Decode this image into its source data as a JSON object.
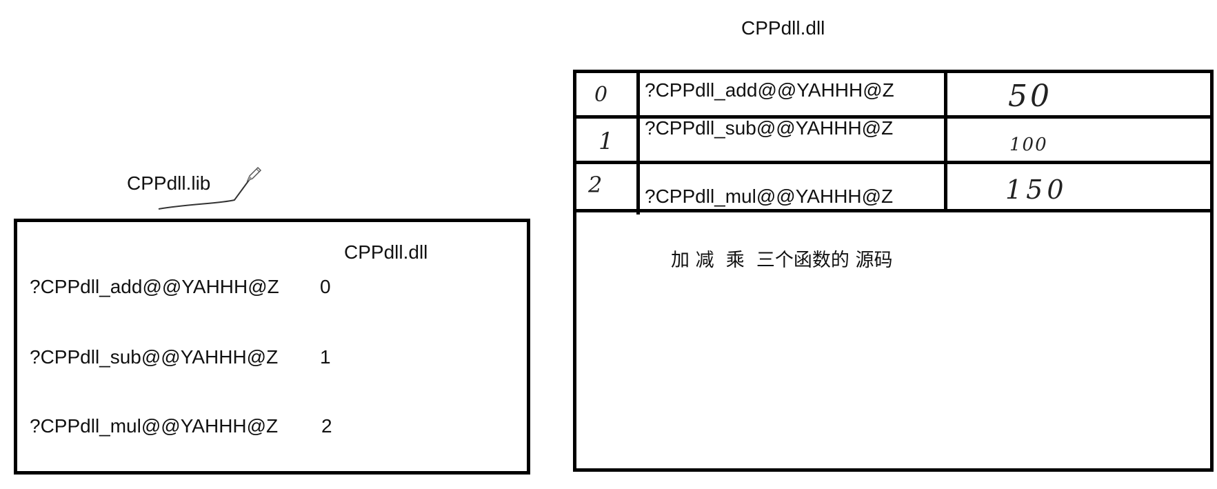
{
  "lib_panel": {
    "title": "CPPdll.lib",
    "inner_title": "CPPdll.dll",
    "exports": [
      {
        "symbol": "?CPPdll_add@@YAHHH@Z",
        "ordinal": "0"
      },
      {
        "symbol": "?CPPdll_sub@@YAHHH@Z",
        "ordinal": "1"
      },
      {
        "symbol": "?CPPdll_mul@@YAHHH@Z",
        "ordinal": "2"
      }
    ]
  },
  "dll_panel": {
    "title": "CPPdll.dll",
    "table": {
      "rows": [
        {
          "index": "0",
          "symbol": "?CPPdll_add@@YAHHH@Z",
          "address": "50"
        },
        {
          "index": "1",
          "symbol": "?CPPdll_sub@@YAHHH@Z",
          "address": "100"
        },
        {
          "index": "2",
          "symbol": "?CPPdll_mul@@YAHHH@Z",
          "address": "150"
        }
      ]
    },
    "source_note": "加 减  乘  三个函数的 源码"
  },
  "annotations": {
    "ink_color": "#000000",
    "pencil_icon": "pencil-icon"
  }
}
